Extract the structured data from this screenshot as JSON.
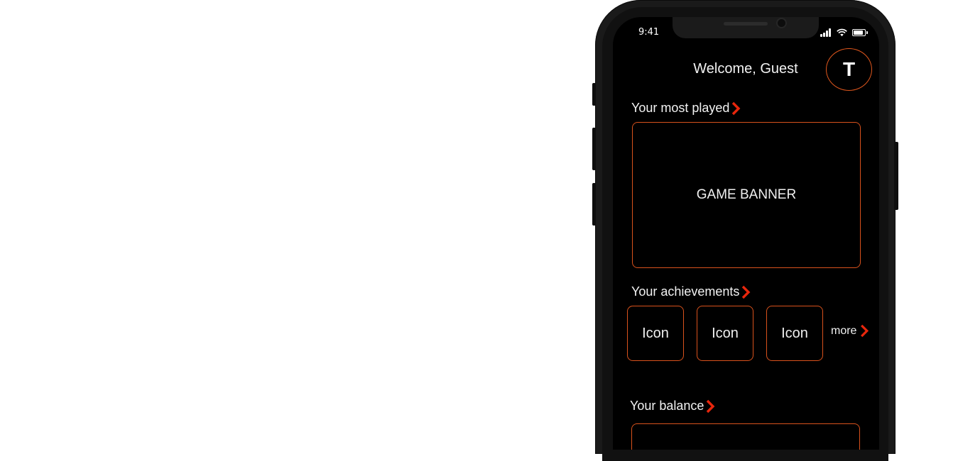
{
  "status_bar": {
    "time": "9:41"
  },
  "header": {
    "welcome": "Welcome, Guest",
    "avatar_letter": "T"
  },
  "sections": {
    "most_played": {
      "title": "Your most played",
      "banner_label": "GAME BANNER"
    },
    "achievements": {
      "title": "Your achievements",
      "icons": [
        "Icon",
        "Icon",
        "Icon"
      ],
      "more_label": "more"
    },
    "balance": {
      "title": "Your balance"
    }
  },
  "colors": {
    "accent": "#e0571d",
    "chevron": "#e8260c",
    "background": "#000000"
  }
}
